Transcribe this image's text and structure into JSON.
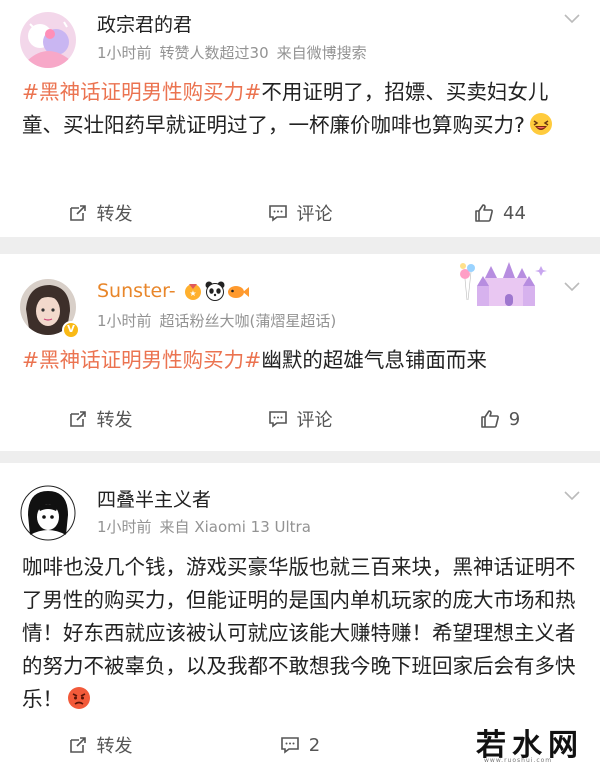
{
  "posts": [
    {
      "name": "政宗君的君",
      "meta": [
        "1小时前",
        "转赞人数超过30",
        "来自微博搜索"
      ],
      "hashtag": "#黑神话证明男性购买力#",
      "text": "不用证明了，招嫖、买卖妇女儿童、买壮阳药早就证明过了，一杯廉价咖啡也算购买力?",
      "emoji": "laughing-emoji",
      "actions": {
        "repost": "转发",
        "comment": "评论",
        "like": "44"
      }
    },
    {
      "name": "Sunster-",
      "meta": [
        "1小时前",
        "超话粉丝大咖(蒲熠星超话)"
      ],
      "hashtag": "#黑神话证明男性购买力#",
      "text": "幽默的超雄气息铺面而来",
      "badges": [
        "medal-icon",
        "panda-icon",
        "fish-icon"
      ],
      "actions": {
        "repost": "转发",
        "comment": "评论",
        "like": "9"
      }
    },
    {
      "name": "四叠半主义者",
      "meta": [
        "1小时前",
        "来自 Xiaomi 13 Ultra"
      ],
      "text": "咖啡也没几个钱，游戏买豪华版也就三百来块，黑神话证明不了男性的购买力，但能证明的是国内单机玩家的庞大市场和热情！好东西就应该被认可就应该能大赚特赚！希望理想主义者的努力不被辜负，以及我都不敢想我今晚下班回家后会有多快乐！",
      "emoji": "angry-emoji",
      "actions": {
        "repost": "转发",
        "comment": "2"
      }
    }
  ],
  "watermark": {
    "text": "若水网",
    "sub": "www.ruoshui.com"
  },
  "colors": {
    "hashtag": "#eb7350",
    "meta": "#939393",
    "name_gold": "#e8862a"
  }
}
